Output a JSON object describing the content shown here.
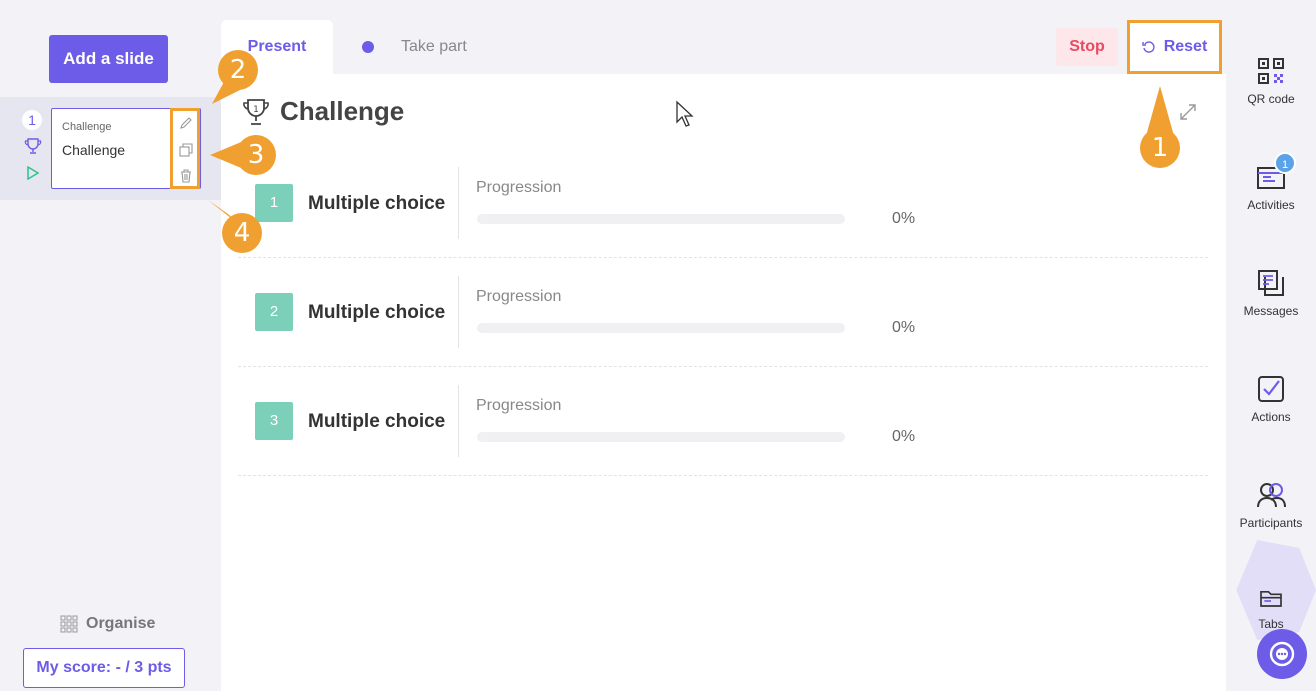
{
  "left": {
    "add_slide": "Add a slide",
    "slide": {
      "number": "1",
      "type": "Challenge",
      "title": "Challenge"
    },
    "organise": "Organise",
    "score": "My score: - / 3 pts"
  },
  "tabs": {
    "present": "Present",
    "take_part": "Take part"
  },
  "actions": {
    "stop": "Stop",
    "reset": "Reset"
  },
  "challenge": {
    "title": "Challenge",
    "rank": "1"
  },
  "questions": [
    {
      "num": "1",
      "title": "Multiple choice",
      "progress_label": "Progression",
      "progress": 0,
      "pct": "0%"
    },
    {
      "num": "2",
      "title": "Multiple choice",
      "progress_label": "Progression",
      "progress": 0,
      "pct": "0%"
    },
    {
      "num": "3",
      "title": "Multiple choice",
      "progress_label": "Progression",
      "progress": 0,
      "pct": "0%"
    }
  ],
  "rail": {
    "qr": "QR code",
    "activities": "Activities",
    "activities_badge": "1",
    "messages": "Messages",
    "actions": "Actions",
    "participants": "Participants",
    "tabs": "Tabs"
  },
  "callouts": [
    "1",
    "2",
    "3",
    "4"
  ],
  "colors": {
    "accent": "#6c5ce7",
    "highlight": "#f0a030",
    "question": "#7ccfb8",
    "stop": "#e84a5f"
  }
}
